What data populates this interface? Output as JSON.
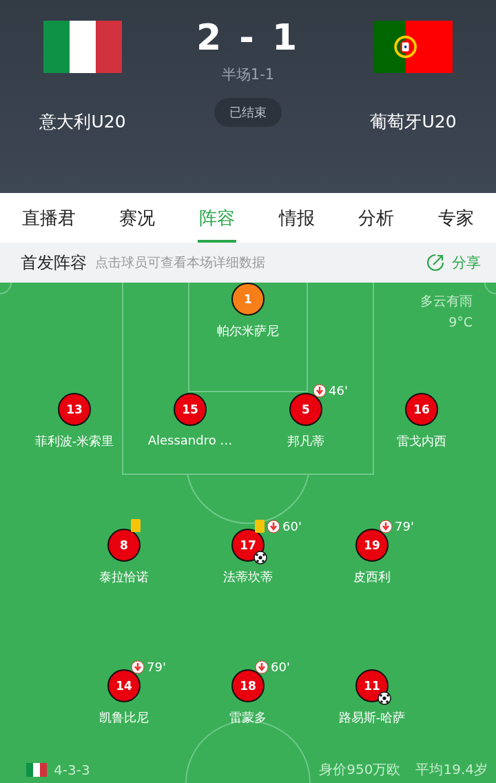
{
  "match": {
    "home": {
      "name": "意大利U20"
    },
    "away": {
      "name": "葡萄牙U20"
    },
    "score": "2 - 1",
    "half_time": "半场1-1",
    "status": "已结束"
  },
  "tabs": [
    {
      "label": "直播君",
      "selected": false
    },
    {
      "label": "赛况",
      "selected": false
    },
    {
      "label": "阵容",
      "selected": true
    },
    {
      "label": "情报",
      "selected": false
    },
    {
      "label": "分析",
      "selected": false
    },
    {
      "label": "专家",
      "selected": false
    }
  ],
  "lineup_bar": {
    "title": "首发阵容",
    "hint": "点击球员可查看本场详细数据",
    "share": "分享"
  },
  "weather": {
    "condition": "多云有雨",
    "temperature": "9°C"
  },
  "lines": [
    {
      "players": [
        {
          "number": "1",
          "name": "帕尔米萨尼",
          "kind": "goalkeeper"
        }
      ]
    },
    {
      "players": [
        {
          "number": "13",
          "name": "菲利波-米索里",
          "kind": "outfield"
        },
        {
          "number": "15",
          "name": "Alessandro …",
          "kind": "outfield"
        },
        {
          "number": "5",
          "name": "邦凡蒂",
          "kind": "outfield",
          "sub_out": "46'"
        },
        {
          "number": "16",
          "name": "雷戈内西",
          "kind": "outfield"
        }
      ]
    },
    {
      "players": [
        {
          "number": "8",
          "name": "泰拉恰诺",
          "kind": "outfield",
          "yellow_card": true
        },
        {
          "number": "17",
          "name": "法蒂坎蒂",
          "kind": "outfield",
          "yellow_card": true,
          "goal": true,
          "sub_out": "60'"
        },
        {
          "number": "19",
          "name": "皮西利",
          "kind": "outfield",
          "sub_out": "79'"
        }
      ]
    },
    {
      "players": [
        {
          "number": "14",
          "name": "凯鲁比尼",
          "kind": "outfield",
          "sub_out": "79'"
        },
        {
          "number": "18",
          "name": "雷蒙多",
          "kind": "outfield",
          "sub_out": "60'"
        },
        {
          "number": "11",
          "name": "路易斯-哈萨",
          "kind": "outfield",
          "goal": true
        }
      ]
    }
  ],
  "footer": {
    "formation": "4-3-3",
    "value": "身价950万欧",
    "average_age": "平均19.4岁"
  }
}
